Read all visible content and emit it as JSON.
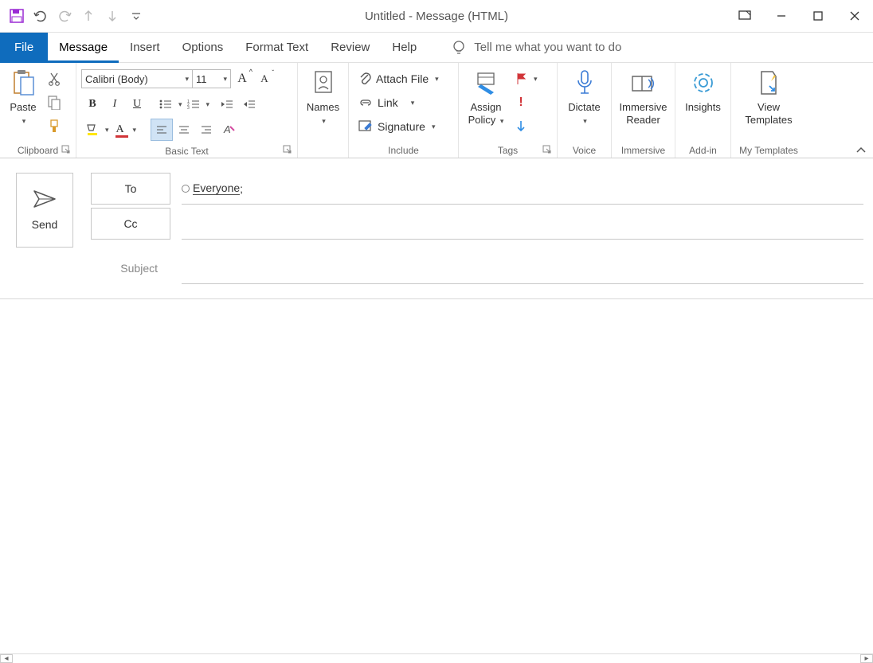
{
  "title": "Untitled  -  Message (HTML)",
  "tabs": [
    "File",
    "Message",
    "Insert",
    "Options",
    "Format Text",
    "Review",
    "Help"
  ],
  "active_tab": "Message",
  "tellme_placeholder": "Tell me what you want to do",
  "ribbon": {
    "clipboard": {
      "label": "Clipboard",
      "paste": "Paste"
    },
    "basictext": {
      "label": "Basic Text",
      "font_name": "Calibri (Body)",
      "font_size": "11"
    },
    "names": {
      "label": "",
      "button": "Names"
    },
    "include": {
      "label": "Include",
      "attach": "Attach File",
      "link": "Link",
      "signature": "Signature"
    },
    "tags": {
      "label": "Tags",
      "assign": "Assign\nPolicy"
    },
    "voice": {
      "label": "Voice",
      "dictate": "Dictate"
    },
    "immersive": {
      "label": "Immersive",
      "reader": "Immersive\nReader"
    },
    "addin": {
      "label": "Add-in",
      "insights": "Insights"
    },
    "templates": {
      "label": "My Templates",
      "view": "View\nTemplates"
    }
  },
  "compose": {
    "send": "Send",
    "to_label": "To",
    "cc_label": "Cc",
    "subject_label": "Subject",
    "to_recipient": "Everyone",
    "to_value_suffix": ";"
  }
}
